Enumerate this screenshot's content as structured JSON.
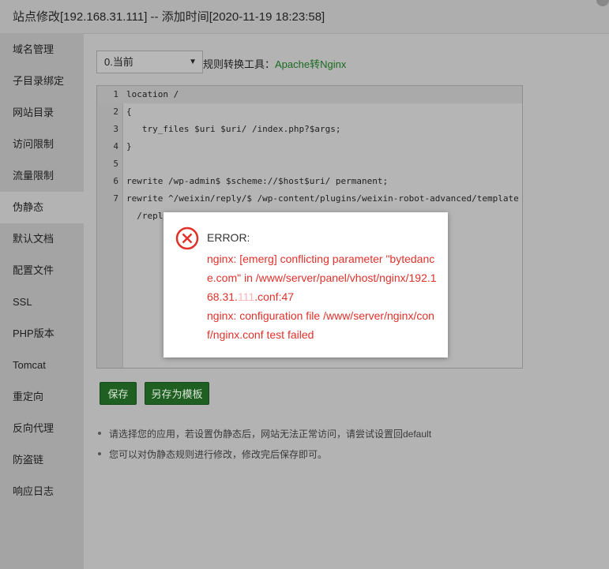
{
  "window": {
    "title": "站点修改[192.168.31.111] -- 添加时间[2020-11-19 18:23:58]"
  },
  "sidebar": {
    "items": [
      {
        "label": "域名管理"
      },
      {
        "label": "子目录绑定"
      },
      {
        "label": "网站目录"
      },
      {
        "label": "访问限制"
      },
      {
        "label": "流量限制"
      },
      {
        "label": "伪静态",
        "active": true
      },
      {
        "label": "默认文档"
      },
      {
        "label": "配置文件"
      },
      {
        "label": "SSL"
      },
      {
        "label": "PHP版本"
      },
      {
        "label": "Tomcat"
      },
      {
        "label": "重定向"
      },
      {
        "label": "反向代理"
      },
      {
        "label": "防盗链"
      },
      {
        "label": "响应日志"
      }
    ]
  },
  "rewrite": {
    "select_value": "0.当前",
    "tool_label": "规则转换工具：",
    "tool_link": "Apache转Nginx",
    "editor": {
      "lines": [
        {
          "num": "1",
          "text": "location /"
        },
        {
          "num": "2",
          "text": "{"
        },
        {
          "num": "3",
          "text": "   try_files $uri $uri/ /index.php?$args;"
        },
        {
          "num": "4",
          "text": "}"
        },
        {
          "num": "5",
          "text": ""
        },
        {
          "num": "6",
          "text": "rewrite /wp-admin$ $scheme://$host$uri/ permanent;"
        },
        {
          "num": "7",
          "text": "rewrite ^/weixin/reply/$ /wp-content/plugins/weixin-robot-advanced/template"
        },
        {
          "num": "",
          "text": "  /repl"
        }
      ]
    },
    "save_label": "保存",
    "save_as_template_label": "另存为模板",
    "notes": [
      "请选择您的应用，若设置伪静态后，网站无法正常访问，请尝试设置回default",
      "您可以对伪静态规则进行修改，修改完后保存即可。"
    ]
  },
  "error_dialog": {
    "title": "ERROR:",
    "message_part1": "nginx: [emerg] conflicting parameter \"bytedance.com\" in /www/server/panel/vhost/nginx/192.168.31.",
    "message_redacted": "111",
    "message_part2": ".conf:47",
    "message_line2": "nginx: configuration file /www/server/nginx/conf/nginx.conf test failed",
    "icon": "error-circle-x-icon",
    "color": "#e0312b"
  }
}
